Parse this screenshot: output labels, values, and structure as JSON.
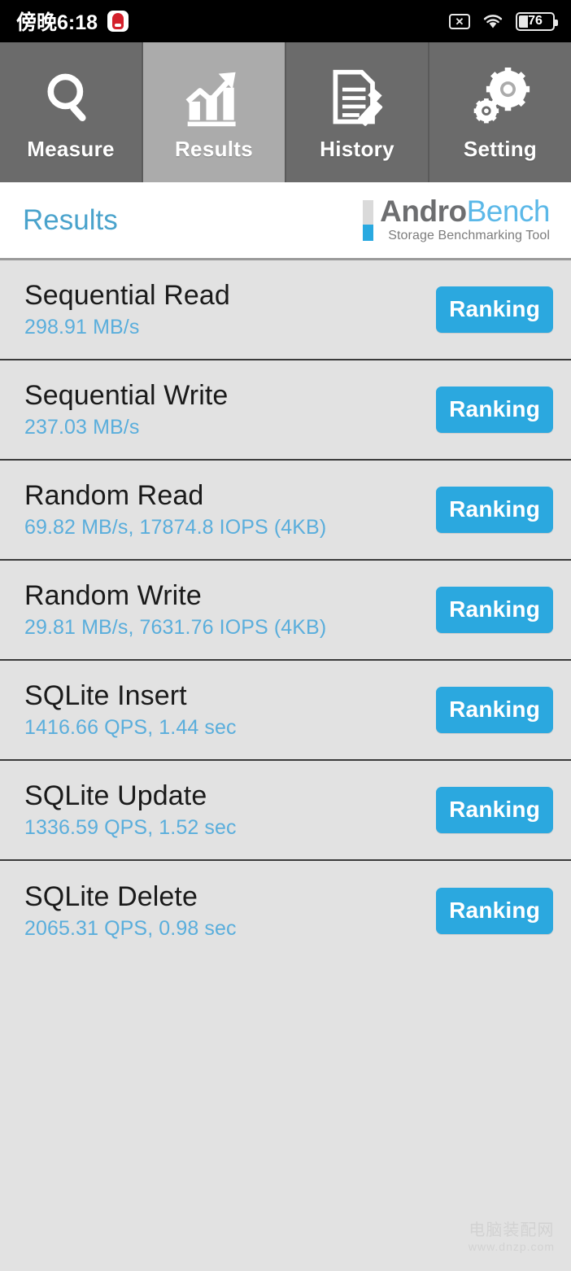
{
  "statusbar": {
    "time": "傍晚6:18",
    "app_icon": "antutu-icon",
    "nosim_icon": "no-sim-icon",
    "nosim_glyph": "✕",
    "wifi_icon": "wifi-icon",
    "battery_icon": "battery-icon",
    "battery_level": "76"
  },
  "tabbar": {
    "tabs": [
      {
        "label": "Measure",
        "icon": "magnifier-icon",
        "active": false
      },
      {
        "label": "Results",
        "icon": "bar-chart-arrow-icon",
        "active": true
      },
      {
        "label": "History",
        "icon": "document-pencil-icon",
        "active": false
      },
      {
        "label": "Setting",
        "icon": "gears-icon",
        "active": false
      }
    ]
  },
  "header": {
    "title": "Results",
    "logo": {
      "part1": "Andro",
      "part2": "Bench",
      "tagline": "Storage Benchmarking Tool"
    }
  },
  "results": {
    "ranking_label": "Ranking",
    "rows": [
      {
        "title": "Sequential Read",
        "value": "298.91 MB/s"
      },
      {
        "title": "Sequential Write",
        "value": "237.03 MB/s"
      },
      {
        "title": "Random Read",
        "value": "69.82 MB/s, 17874.8 IOPS (4KB)"
      },
      {
        "title": "Random Write",
        "value": "29.81 MB/s, 7631.76 IOPS (4KB)"
      },
      {
        "title": "SQLite Insert",
        "value": "1416.66 QPS, 1.44 sec"
      },
      {
        "title": "SQLite Update",
        "value": "1336.59 QPS, 1.52 sec"
      },
      {
        "title": "SQLite Delete",
        "value": "2065.31 QPS, 0.98 sec"
      }
    ]
  },
  "watermark": {
    "line1": "电脑装配网",
    "line2": "www.dnzp.com"
  },
  "colors": {
    "accent_blue": "#2BA8DF",
    "value_blue": "#5AAEDC",
    "title_blue": "#4AA3CC",
    "tab_inactive": "#6B6B6B",
    "tab_active": "#ABABAB",
    "list_bg": "#E2E2E2",
    "status_bg": "#000000"
  }
}
